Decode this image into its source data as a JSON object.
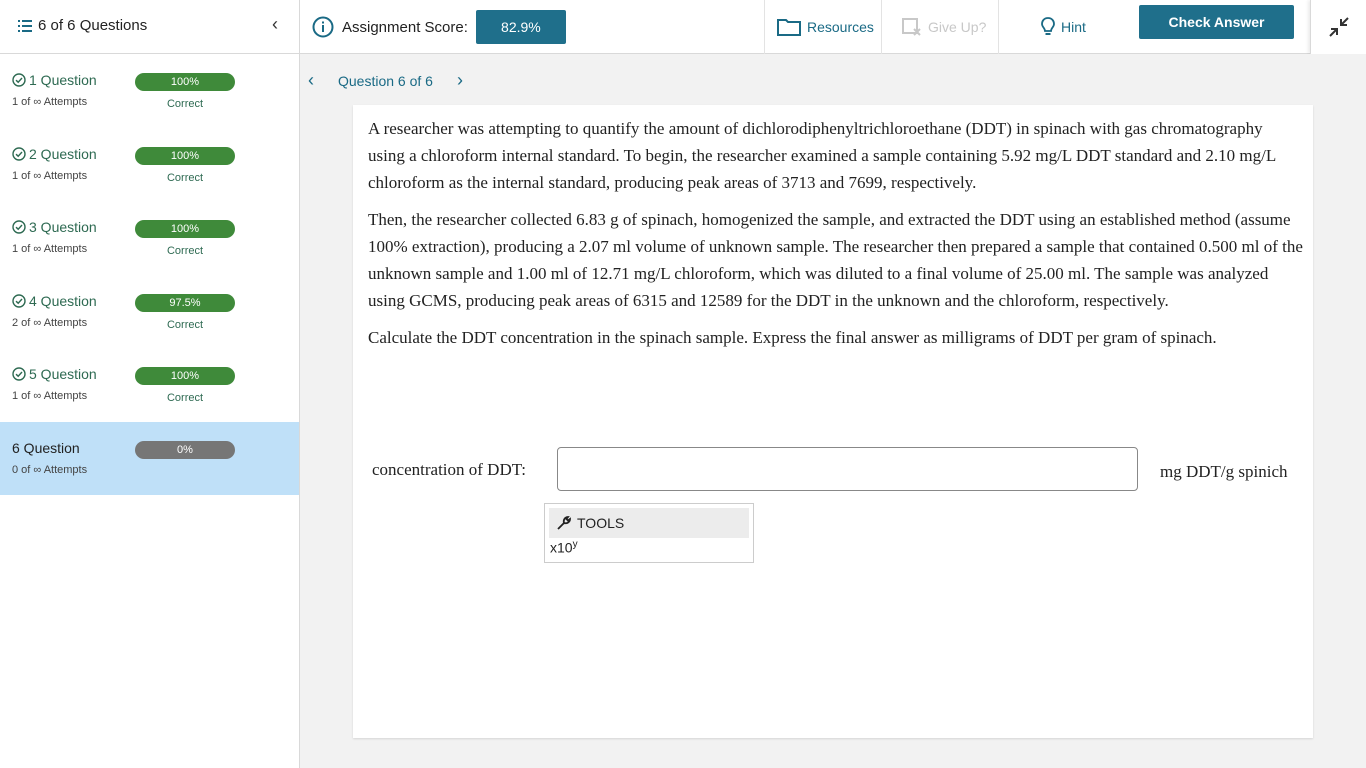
{
  "header": {
    "questions_toggle": "6 of 6 Questions",
    "score_label": "Assignment Score:",
    "score_value": "82.9%",
    "resources": "Resources",
    "give_up": "Give Up?",
    "hint": "Hint",
    "check_answer": "Check Answer"
  },
  "sidebar": {
    "items": [
      {
        "title": "1 Question",
        "attempts": "1 of ∞ Attempts",
        "score": "100%",
        "status": "Correct"
      },
      {
        "title": "2 Question",
        "attempts": "1 of ∞ Attempts",
        "score": "100%",
        "status": "Correct"
      },
      {
        "title": "3 Question",
        "attempts": "1 of ∞ Attempts",
        "score": "100%",
        "status": "Correct"
      },
      {
        "title": "4 Question",
        "attempts": "2 of ∞ Attempts",
        "score": "97.5%",
        "status": "Correct"
      },
      {
        "title": "5 Question",
        "attempts": "1 of ∞ Attempts",
        "score": "100%",
        "status": "Correct"
      },
      {
        "title": "6 Question",
        "attempts": "0 of ∞ Attempts",
        "score": "0%",
        "status": ""
      }
    ]
  },
  "main": {
    "question_nav_label": "Question 6 of 6",
    "paragraphs": [
      "A researcher was attempting to quantify the amount of dichlorodiphenyltrichloroethane (DDT) in spinach with gas chromatography using a chloroform internal standard. To begin, the researcher examined a sample containing 5.92 mg/L DDT standard and 2.10 mg/L chloroform as the internal standard, producing peak areas of 3713 and 7699, respectively.",
      "Then, the researcher collected 6.83 g of spinach, homogenized the sample, and extracted the DDT using an established method (assume 100% extraction), producing a 2.07 ml volume of unknown sample. The researcher then prepared a sample that contained 0.500 ml of the unknown sample and 1.00 ml of 12.71 mg/L chloroform, which was diluted to a final volume of 25.00 ml. The sample was analyzed using GCMS, producing peak areas of 6315 and 12589 for the DDT in the unknown and the chloroform, respectively.",
      "Calculate the DDT concentration in the spinach sample. Express the final answer as milligrams of DDT per gram of spinach."
    ],
    "answer_label": "concentration of DDT:",
    "answer_value": "",
    "answer_unit": "mg DDT/g spinich",
    "tools_label": "TOOLS",
    "x10_base": "x10",
    "x10_exp": "y"
  },
  "colors": {
    "accent": "#1f6f8b",
    "correct_bar": "#3f8a3a",
    "zero_bar": "#767676",
    "active_row": "#bfe0f8"
  }
}
